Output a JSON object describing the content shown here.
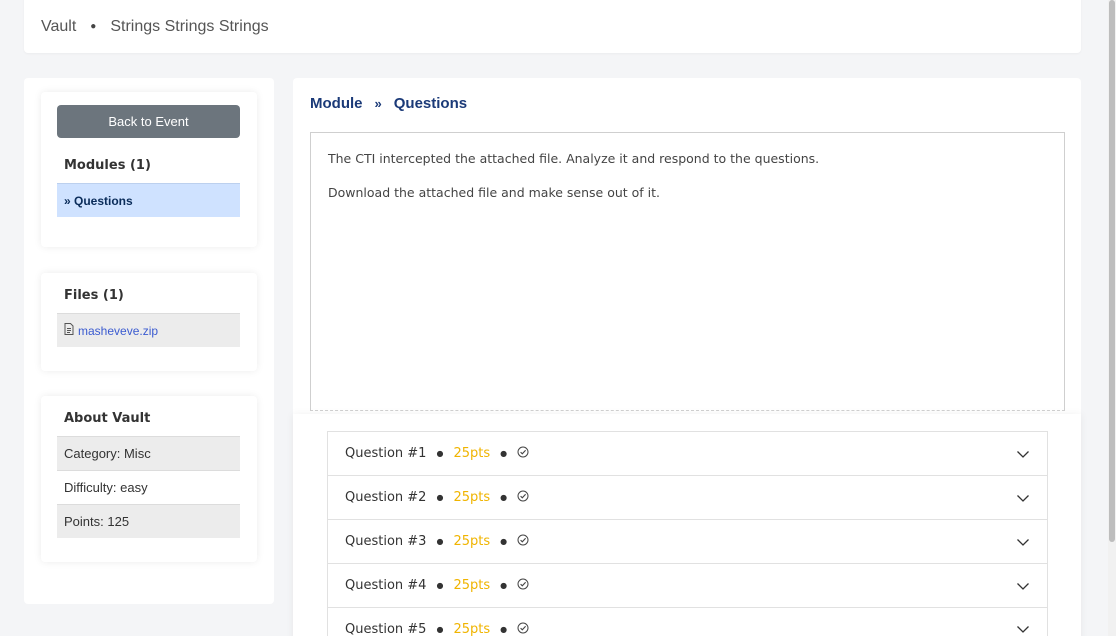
{
  "header": {
    "event_name": "Vault",
    "subtitle": "Strings Strings Strings"
  },
  "sidebar": {
    "back_button": "Back to Event",
    "modules_title": "Modules (1)",
    "modules": [
      {
        "label": "» Questions"
      }
    ],
    "files_title": "Files (1)",
    "files": [
      {
        "name": "masheveve.zip",
        "icon": "file-icon"
      }
    ],
    "about_title": "About Vault",
    "about": [
      {
        "label": "Category: Misc"
      },
      {
        "label": "Difficulty: easy"
      },
      {
        "label": "Points: 125"
      }
    ]
  },
  "main": {
    "breadcrumb": {
      "first": "Module",
      "separator": "»",
      "second": "Questions"
    },
    "description": [
      "The CTI intercepted the attached file. Analyze it and respond to the questions.",
      "Download the attached file and make sense out of it."
    ],
    "questions": [
      {
        "title": "Question #1",
        "points": "25pts"
      },
      {
        "title": "Question #2",
        "points": "25pts"
      },
      {
        "title": "Question #3",
        "points": "25pts"
      },
      {
        "title": "Question #4",
        "points": "25pts"
      },
      {
        "title": "Question #5",
        "points": "25pts"
      }
    ]
  },
  "colors": {
    "points": "#f0b400",
    "breadcrumb": "#1b3a78",
    "active_module_bg": "#cfe2ff",
    "back_button_bg": "#6c757d",
    "file_link": "#3b5bd0"
  }
}
